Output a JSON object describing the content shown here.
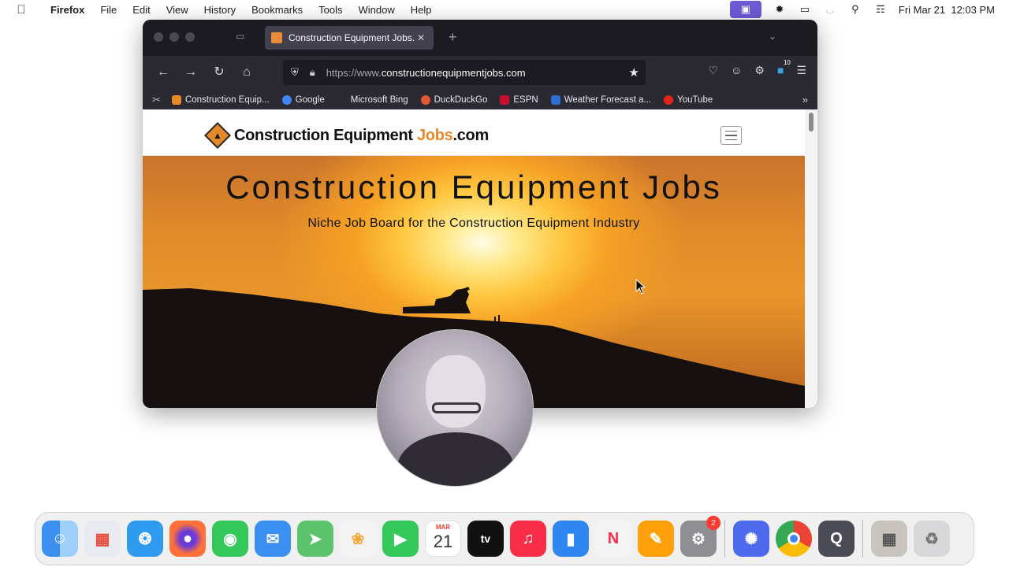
{
  "menubar": {
    "app_name": "Firefox",
    "items": [
      "File",
      "Edit",
      "View",
      "History",
      "Bookmarks",
      "Tools",
      "Window",
      "Help"
    ],
    "clock": "Fri Mar 21  12:03 PM"
  },
  "browser": {
    "tab_title": "Construction Equipment Jobs.c",
    "url_prefix": "https://www.",
    "url_host": "constructionequipmentjobs.com",
    "extension_badge": "10",
    "bookmarks": [
      {
        "label": "Construction Equip...",
        "color": "#e5892c"
      },
      {
        "label": "Google",
        "color": "#4285f4"
      },
      {
        "label": "Microsoft Bing",
        "color": "#2b2a33"
      },
      {
        "label": "DuckDuckGo",
        "color": "#de5833"
      },
      {
        "label": "ESPN",
        "color": "#c8102e"
      },
      {
        "label": "Weather Forecast a...",
        "color": "#2d6fcf"
      },
      {
        "label": "YouTube",
        "color": "#e62117"
      }
    ]
  },
  "site": {
    "logo_main": "Construction Equipment ",
    "logo_accent": "Jobs",
    "logo_tld": ".com",
    "hero_title": "Construction Equipment Jobs",
    "hero_subtitle": "Niche Job Board for the Construction Equipment Industry"
  },
  "dock": {
    "calendar_month": "MAR",
    "calendar_day": "21",
    "settings_badge": "2",
    "apps": [
      {
        "name": "finder",
        "color": "#3b8ff0"
      },
      {
        "name": "launchpad",
        "color": "#e9eaef"
      },
      {
        "name": "safari",
        "color": "#2f9bf0"
      },
      {
        "name": "firefox",
        "color": "#ff7139"
      },
      {
        "name": "messages",
        "color": "#34c759"
      },
      {
        "name": "mail",
        "color": "#3b8ff0"
      },
      {
        "name": "maps",
        "color": "#5ac36b"
      },
      {
        "name": "photos",
        "color": "#f4f4f4"
      },
      {
        "name": "facetime",
        "color": "#34c759"
      },
      {
        "name": "calendar",
        "color": "#ffffff"
      },
      {
        "name": "apple-tv",
        "color": "#111111"
      },
      {
        "name": "music",
        "color": "#fa2d48"
      },
      {
        "name": "keynote",
        "color": "#2f86f0"
      },
      {
        "name": "news",
        "color": "#f4f4f4"
      },
      {
        "name": "pages",
        "color": "#ff9f0a"
      },
      {
        "name": "system-settings",
        "color": "#8e8e93"
      },
      {
        "name": "perplexity",
        "color": "#4f6bed"
      },
      {
        "name": "chrome",
        "color": "#f4f4f4"
      },
      {
        "name": "quicktime",
        "color": "#4b4b55"
      },
      {
        "name": "downloads",
        "color": "#c9c4be"
      },
      {
        "name": "trash",
        "color": "#d8d8da"
      }
    ]
  }
}
